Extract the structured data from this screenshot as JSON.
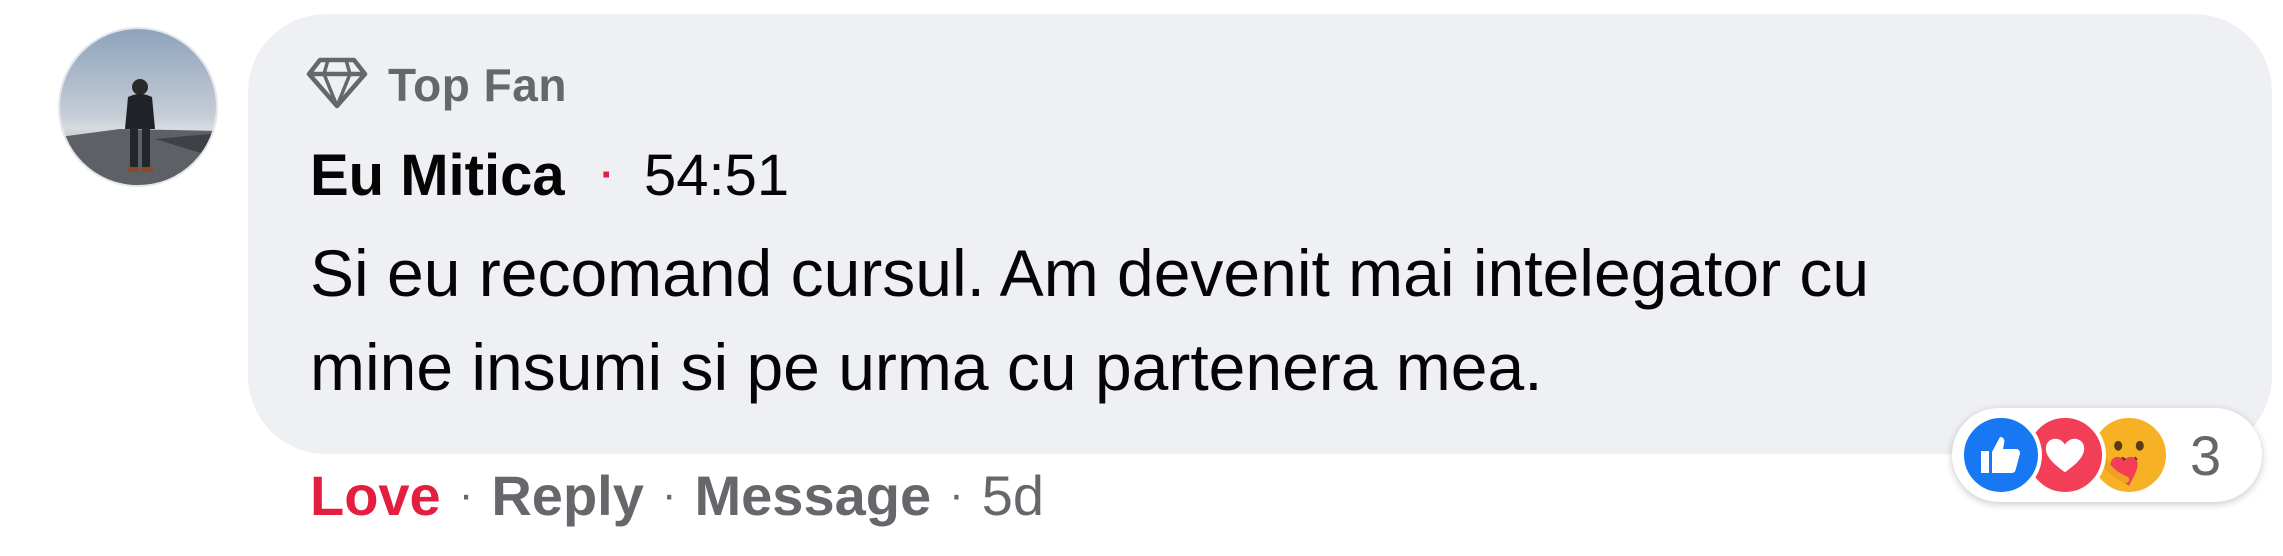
{
  "comment": {
    "badge_label": "Top Fan",
    "author": "Eu Mitica",
    "separator": "·",
    "timestamp": "54:51",
    "text_line1": "Si eu recomand cursul. Am devenit mai intelegator cu",
    "text_line2": "mine insumi si pe urma cu partenera mea."
  },
  "actions": {
    "love_label": "Love",
    "reply_label": "Reply",
    "message_label": "Message",
    "age": "5d",
    "separator": "·"
  },
  "reactions": {
    "count": "3",
    "types": [
      "like-icon",
      "love-icon",
      "care-icon"
    ]
  },
  "colors": {
    "bubble": "#eff0f4",
    "love_accent": "#e41e3f",
    "secondary_text": "#65676b",
    "like_blue": "#1877f2",
    "love_red": "#f33e58",
    "care_yellow": "#f7b125"
  }
}
